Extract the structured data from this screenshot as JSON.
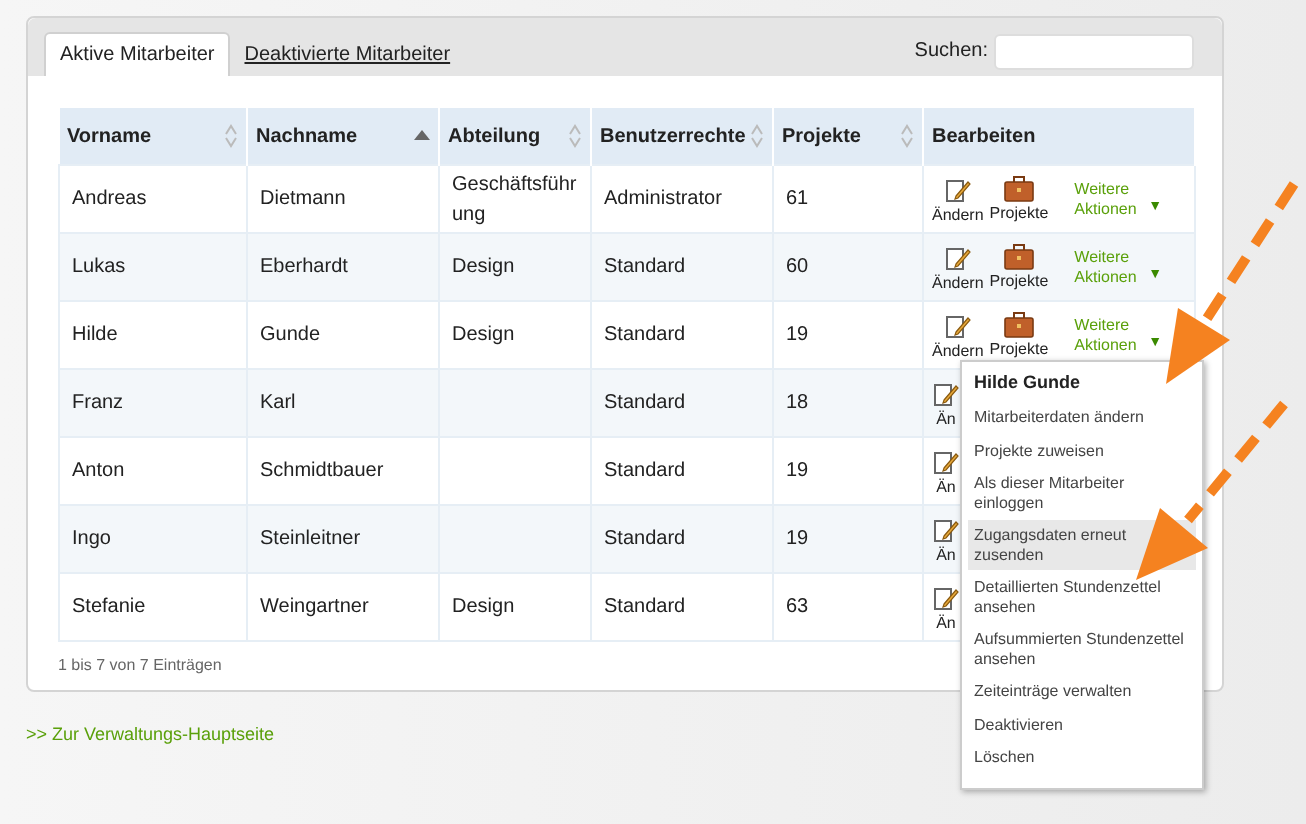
{
  "tabs": [
    {
      "label": "Aktive Mitarbeiter",
      "selected": true
    },
    {
      "label": "Deaktivierte Mitarbeiter",
      "selected": false
    }
  ],
  "search": {
    "label": "Suchen:"
  },
  "table": {
    "columns": [
      {
        "label": "Vorname",
        "sortable": true,
        "sorted": false
      },
      {
        "label": "Nachname",
        "sortable": true,
        "sorted": true
      },
      {
        "label": "Abteilung",
        "sortable": true,
        "sorted": false
      },
      {
        "label": "Benutzerrechte",
        "sortable": true,
        "sorted": false
      },
      {
        "label": "Projekte",
        "sortable": true,
        "sorted": false
      },
      {
        "label": "Bearbeiten"
      }
    ],
    "rows": [
      {
        "cells": [
          "Andreas",
          "Dietmann",
          "Geschäftsführung",
          "Administrator",
          "61"
        ],
        "edit_label": "Ändern",
        "projects_label": "Projekte",
        "more_label": "Weitere Aktionen",
        "more_icon": "▼"
      },
      {
        "cells": [
          "Lukas",
          "Eberhardt",
          "Design",
          "Standard",
          "60"
        ],
        "edit_label": "Ändern",
        "projects_label": "Projekte",
        "more_label": "Weitere Aktionen",
        "more_icon": "▼"
      },
      {
        "cells": [
          "Hilde",
          "Gunde",
          "Design",
          "Standard",
          "19"
        ],
        "edit_label": "Ändern",
        "projects_label": "Projekte",
        "more_label": "Weitere Aktionen",
        "more_icon": "▼"
      },
      {
        "cells": [
          "Franz",
          "Karl",
          "",
          "Standard",
          "18"
        ],
        "edit_label": "Än"
      },
      {
        "cells": [
          "Anton",
          "Schmidtbauer",
          "",
          "Standard",
          "19"
        ],
        "edit_label": "Än"
      },
      {
        "cells": [
          "Ingo",
          "Steinleitner",
          "",
          "Standard",
          "19"
        ],
        "edit_label": "Än"
      },
      {
        "cells": [
          "Stefanie",
          "Weingartner",
          "Design",
          "Standard",
          "63"
        ],
        "edit_label": "Än"
      }
    ],
    "info": "1 bis 7 von 7 Einträgen"
  },
  "menu": {
    "title": "Hilde Gunde",
    "items": [
      {
        "label": "Mitarbeiterdaten ändern",
        "selected": false
      },
      {
        "label": "Projekte zuweisen",
        "selected": false
      },
      {
        "label": "Als dieser Mitarbeiter einloggen",
        "selected": false
      },
      {
        "label": "Zugangsdaten erneut zusenden",
        "selected": true
      },
      {
        "label": "Detaillierten Stundenzettel ansehen",
        "selected": false
      },
      {
        "label": "Aufsummierten Stundenzettel ansehen",
        "selected": false
      },
      {
        "label": "Zeiteinträge verwalten",
        "selected": false
      },
      {
        "label": "Deaktivieren",
        "selected": false
      },
      {
        "label": "Löschen",
        "selected": false
      }
    ]
  },
  "back_link": ">> Zur Verwaltungs-Hauptseite"
}
